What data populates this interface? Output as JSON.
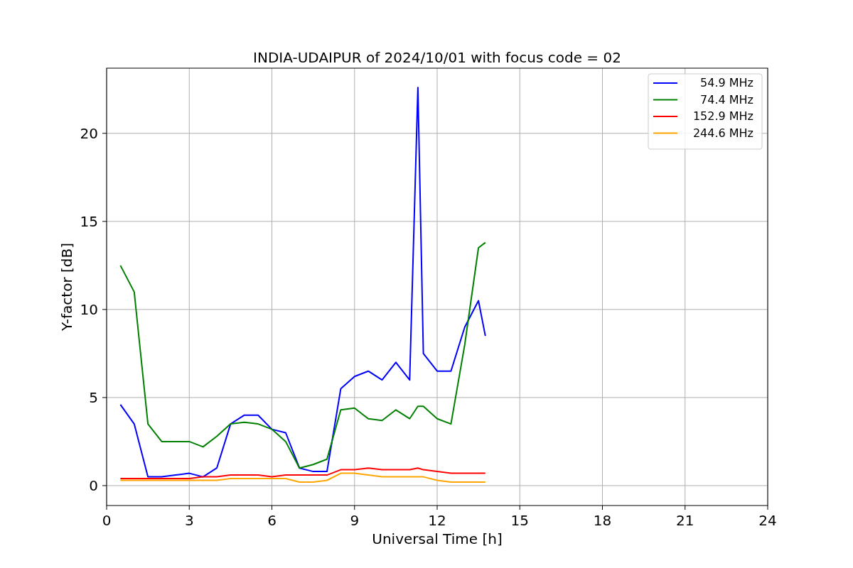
{
  "figure": {
    "chart_data": {
      "type": "line",
      "title": "INDIA-UDAIPUR of 2024/10/01 with focus code = 02",
      "xlabel": "Universal Time [h]",
      "ylabel": "Y-factor [dB]",
      "x": [
        0.5,
        1,
        1.5,
        2,
        2.5,
        3,
        3.5,
        4,
        4.5,
        5,
        5.5,
        6,
        6.5,
        7,
        7.5,
        8,
        8.5,
        9,
        9.5,
        10,
        10.5,
        11,
        11.3,
        11.5,
        12,
        12.5,
        13,
        13.5,
        13.75
      ],
      "series": [
        {
          "name": "54.9 MHz",
          "color": "#0000ff",
          "values": [
            4.6,
            3.5,
            0.5,
            0.5,
            0.6,
            0.7,
            0.5,
            1.0,
            3.5,
            4.0,
            4.0,
            3.2,
            3.0,
            1.0,
            0.8,
            0.8,
            5.5,
            6.2,
            6.5,
            6.0,
            7.0,
            6.0,
            22.6,
            7.5,
            6.5,
            6.5,
            9.0,
            10.5,
            8.5
          ]
        },
        {
          "name": "74.4 MHz",
          "color": "#008000",
          "values": [
            12.5,
            11.0,
            3.5,
            2.5,
            2.5,
            2.5,
            2.2,
            2.8,
            3.5,
            3.6,
            3.5,
            3.2,
            2.5,
            1.0,
            1.2,
            1.5,
            4.3,
            4.4,
            3.8,
            3.7,
            4.3,
            3.8,
            4.5,
            4.5,
            3.8,
            3.5,
            8.0,
            13.5,
            13.8
          ]
        },
        {
          "name": "152.9 MHz",
          "color": "#ff0000",
          "values": [
            0.4,
            0.4,
            0.4,
            0.4,
            0.4,
            0.4,
            0.5,
            0.5,
            0.6,
            0.6,
            0.6,
            0.5,
            0.6,
            0.6,
            0.6,
            0.6,
            0.9,
            0.9,
            1.0,
            0.9,
            0.9,
            0.9,
            1.0,
            0.9,
            0.8,
            0.7,
            0.7,
            0.7,
            0.7
          ]
        },
        {
          "name": "244.6 MHz",
          "color": "#ffa500",
          "values": [
            0.3,
            0.3,
            0.3,
            0.3,
            0.3,
            0.3,
            0.3,
            0.3,
            0.4,
            0.4,
            0.4,
            0.4,
            0.4,
            0.2,
            0.2,
            0.3,
            0.7,
            0.7,
            0.6,
            0.5,
            0.5,
            0.5,
            0.5,
            0.5,
            0.3,
            0.2,
            0.2,
            0.2,
            0.2
          ]
        }
      ],
      "grid": true,
      "legend": true,
      "xlim": [
        0,
        24
      ],
      "ylim": [
        -1.13,
        23.7
      ],
      "xticks": [
        0,
        3,
        6,
        9,
        12,
        15,
        18,
        21,
        24
      ],
      "yticks": [
        0,
        5,
        10,
        15,
        20
      ]
    }
  }
}
